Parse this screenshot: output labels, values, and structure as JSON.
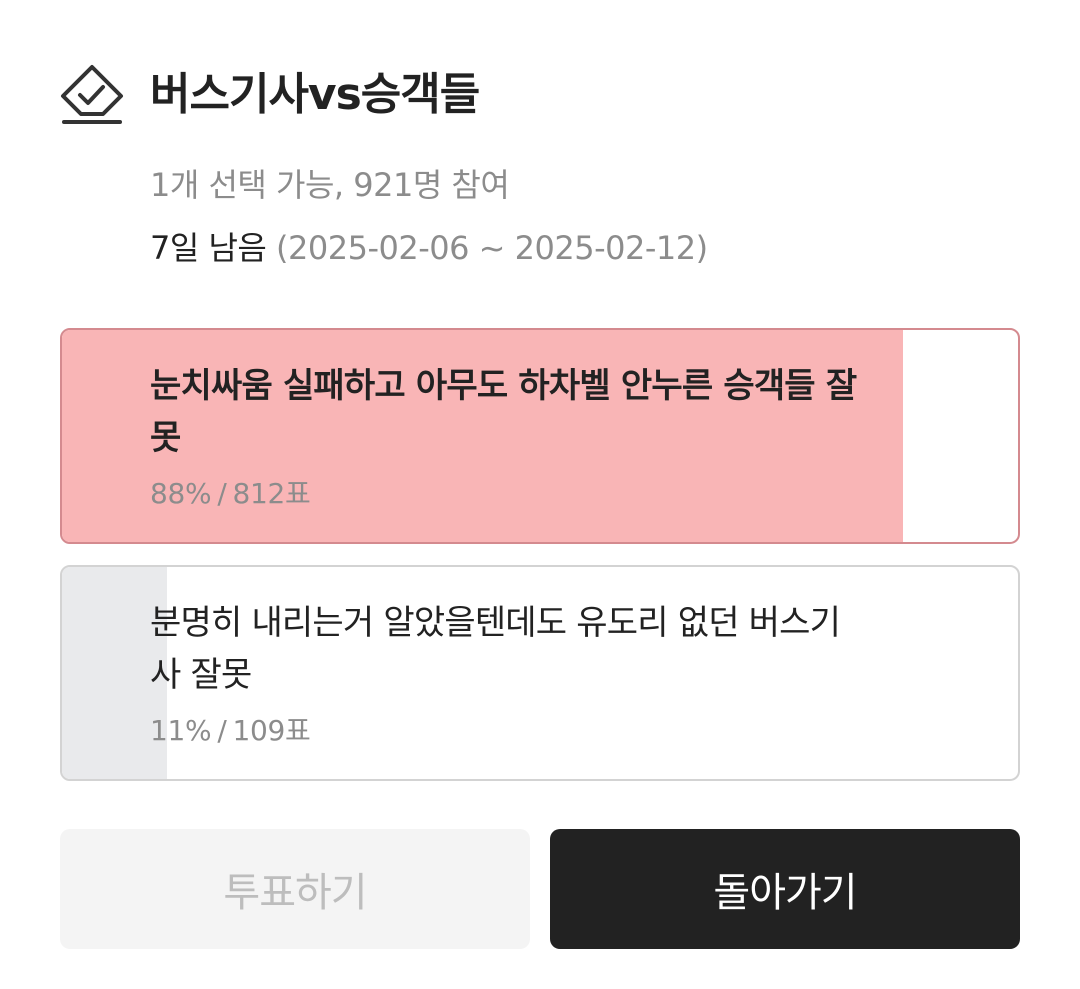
{
  "poll": {
    "title": "버스기사vs승객들",
    "meta": "1개 선택 가능, 921명 참여",
    "remaining": "7일 남음",
    "date_range": "(2025-02-06 ~ 2025-02-12)"
  },
  "options": [
    {
      "label": "눈치싸움 실패하고 아무도 하차벨 안누른 승객들 잘못",
      "percent": "88%",
      "votes": "812표",
      "fill_fraction": 0.88,
      "fill_color": "#f9b5b6",
      "selected": true
    },
    {
      "label": "분명히 내리는거 알았을텐데도 유도리 없던 버스기사 잘못",
      "percent": "11%",
      "votes": "109표",
      "fill_fraction": 0.11,
      "fill_color": "#e9eaec",
      "selected": false
    }
  ],
  "separator": "/",
  "buttons": {
    "vote_label": "투표하기",
    "back_label": "돌아가기"
  },
  "icons": {
    "poll": "ballot-check-icon"
  }
}
